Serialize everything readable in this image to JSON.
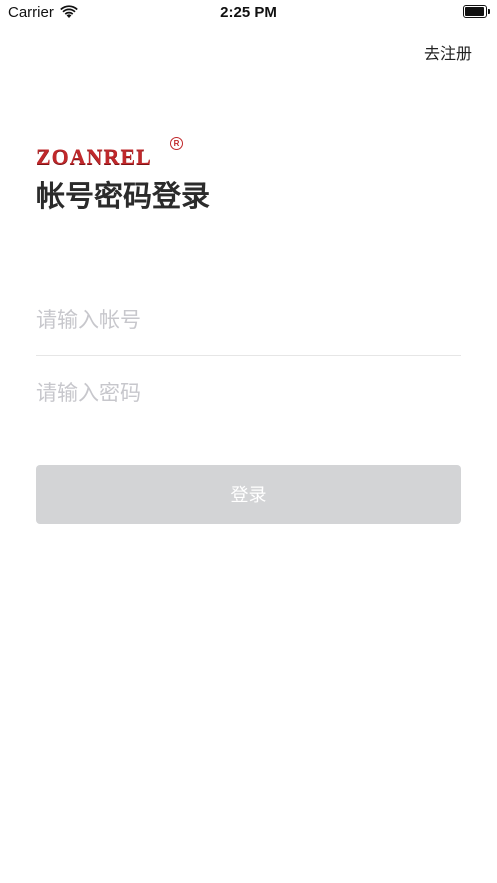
{
  "status_bar": {
    "carrier": "Carrier",
    "time": "2:25 PM"
  },
  "header": {
    "register_link": "去注册"
  },
  "logo": {
    "text": "ZOANREL",
    "registered_mark": "R"
  },
  "page": {
    "title": "帐号密码登录"
  },
  "form": {
    "account_placeholder": "请输入帐号",
    "account_value": "",
    "password_placeholder": "请输入密码",
    "password_value": "",
    "login_label": "登录"
  },
  "colors": {
    "brand_red": "#c0282b",
    "button_disabled": "#d3d4d6",
    "placeholder": "#c7c7cc"
  }
}
